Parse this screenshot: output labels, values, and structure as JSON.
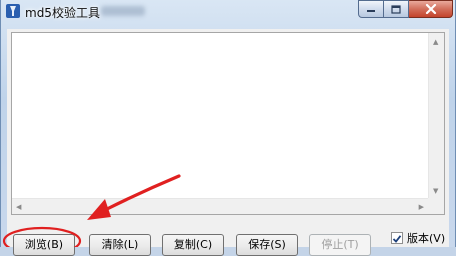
{
  "window": {
    "title": "md5校验工具",
    "icon": "app-tool-icon"
  },
  "caption_buttons": {
    "minimize_icon": "minimize-icon",
    "maximize_icon": "maximize-icon",
    "close_icon": "close-icon"
  },
  "output": {
    "value": ""
  },
  "buttons": {
    "browse": "浏览(B)",
    "clear": "清除(L)",
    "copy": "复制(C)",
    "save": "保存(S)",
    "stop": "停止(T)"
  },
  "options": {
    "version_label": "版本(V)",
    "version_checked": true
  },
  "annotation": {
    "color": "#e02020"
  }
}
